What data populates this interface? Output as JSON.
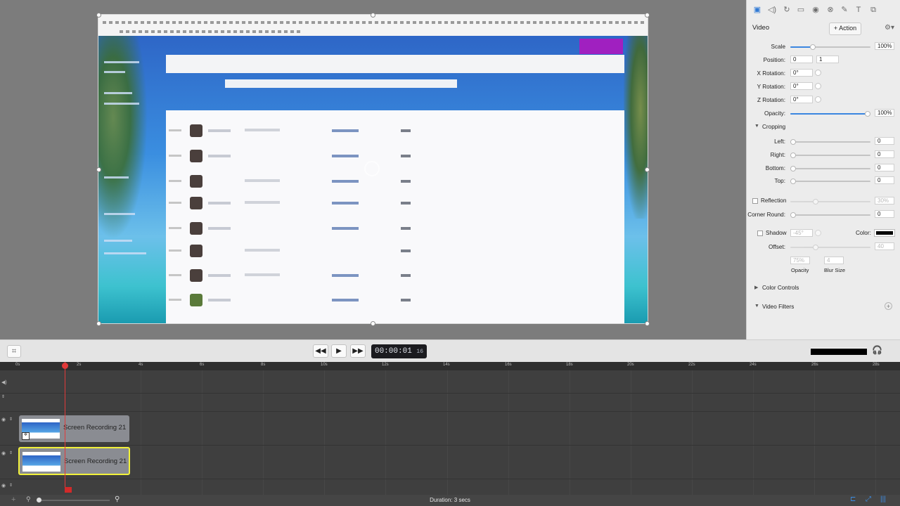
{
  "inspector": {
    "section_title": "Video",
    "action_label": "+ Action",
    "scale": {
      "label": "Scale",
      "value": "100%"
    },
    "position": {
      "label": "Position:",
      "x": "0",
      "y": "1"
    },
    "x_rotation": {
      "label": "X Rotation:",
      "value": "0°"
    },
    "y_rotation": {
      "label": "Y Rotation:",
      "value": "0°"
    },
    "z_rotation": {
      "label": "Z Rotation:",
      "value": "0°"
    },
    "opacity": {
      "label": "Opacity:",
      "value": "100%"
    },
    "cropping": {
      "label": "Cropping",
      "left": {
        "label": "Left:",
        "value": "0"
      },
      "right": {
        "label": "Right:",
        "value": "0"
      },
      "bottom": {
        "label": "Bottom:",
        "value": "0"
      },
      "top": {
        "label": "Top:",
        "value": "0"
      }
    },
    "reflection": {
      "label": "Reflection",
      "value": "30%"
    },
    "corner_round": {
      "label": "Corner Round:",
      "value": "0"
    },
    "shadow": {
      "label": "Shadow",
      "angle": "-45°",
      "color_label": "Color:",
      "color": "#000000"
    },
    "offset": {
      "label": "Offset:",
      "value": "40"
    },
    "shadow_opacity": {
      "label": "Opacity",
      "value": "75%"
    },
    "blur_size": {
      "label": "Blur Size",
      "value": "4"
    },
    "color_controls": "Color Controls",
    "video_filters": "Video Filters"
  },
  "transport": {
    "timecode_main": "00:00:01",
    "timecode_frames": "16"
  },
  "ruler": {
    "labels": [
      "0s",
      "2s",
      "4s",
      "6s",
      "8s",
      "10s",
      "12s",
      "14s",
      "16s",
      "18s",
      "20s",
      "22s",
      "24s",
      "26s",
      "28s"
    ]
  },
  "timeline": {
    "clips": [
      {
        "title": "Screen Recording 21"
      },
      {
        "title": "Screen Recording 21"
      }
    ]
  },
  "status": {
    "duration": "Duration: 3 secs"
  },
  "colors": {
    "accent": "#3b86e0",
    "playhead": "#e13a3a",
    "selected_clip_border": "#f2f23a"
  }
}
